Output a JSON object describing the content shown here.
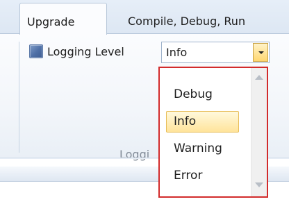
{
  "tabs": [
    {
      "label": "Upgrade",
      "active": true
    },
    {
      "label": "Compile, Debug, Run",
      "active": false
    }
  ],
  "logging": {
    "checkbox_label": "Logging Level",
    "selected_value": "Info"
  },
  "group": {
    "caption": "Loggi"
  },
  "dropdown": {
    "options": [
      "Debug",
      "Info",
      "Warning",
      "Error"
    ],
    "selected": "Info"
  },
  "colors": {
    "highlight_border": "#d22b2b",
    "selected_item_fill": "#ffe49b",
    "accent_checkbox": "#4e6fa6"
  }
}
